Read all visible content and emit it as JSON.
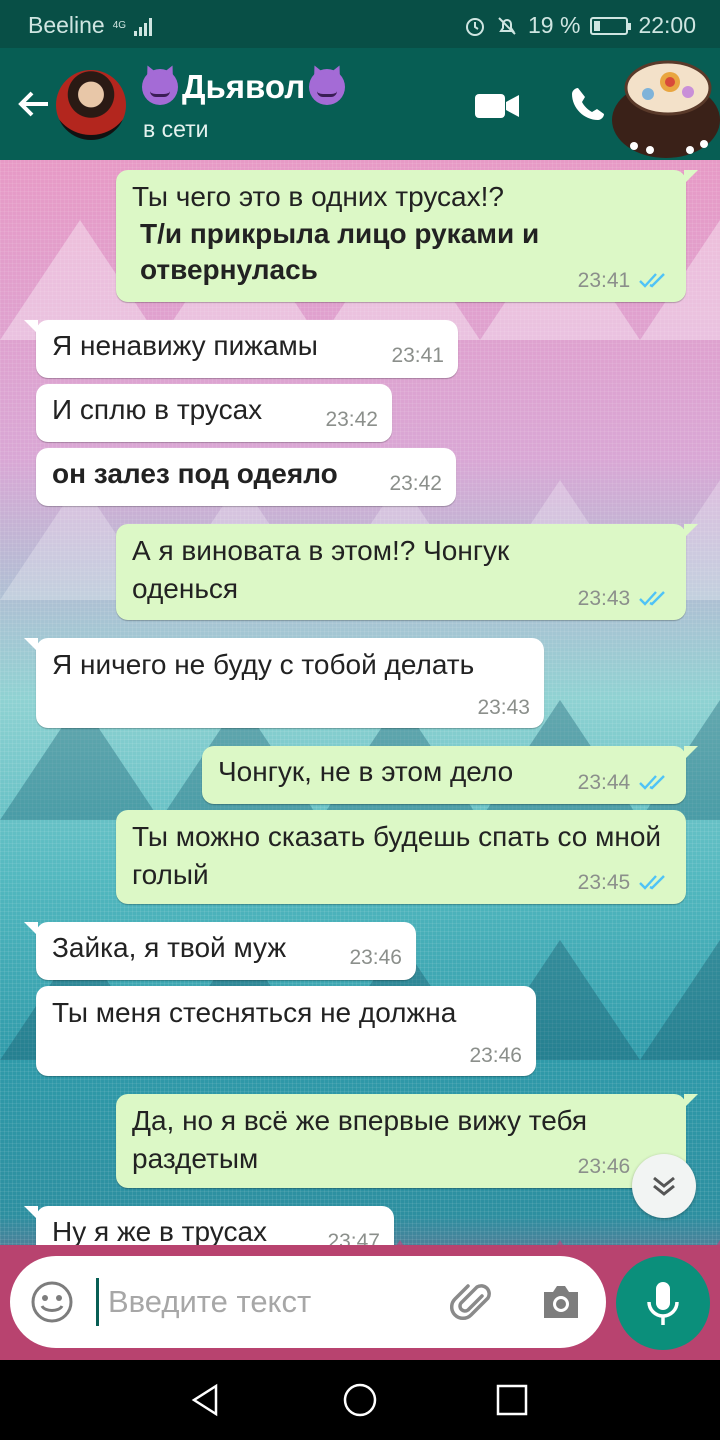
{
  "status_bar": {
    "carrier": "Beeline",
    "network": "4G",
    "battery": "19 %",
    "clock": "22:00"
  },
  "header": {
    "contact_name": "Дьявол",
    "status": "в сети"
  },
  "messages": [
    {
      "dir": "out",
      "text": "Ты чего это в одних трусах!?",
      "bold_text": "Т/и прикрыла лицо руками и отвернулась",
      "time": "23:41",
      "read": true
    },
    {
      "dir": "in",
      "text": "Я ненавижу пижамы",
      "time": "23:41"
    },
    {
      "dir": "in",
      "text": "И сплю в трусах",
      "time": "23:42"
    },
    {
      "dir": "in",
      "text": "он залез под одеяло",
      "bold": true,
      "time": "23:42"
    },
    {
      "dir": "out",
      "text": "А я виновата в этом!? Чонгук оденься",
      "time": "23:43",
      "read": true
    },
    {
      "dir": "in",
      "text": "Я ничего не буду с тобой делать",
      "time": "23:43"
    },
    {
      "dir": "out",
      "text": "Чонгук, не в этом дело",
      "time": "23:44",
      "read": true
    },
    {
      "dir": "out",
      "text": "Ты можно сказать будешь спать со мной голый",
      "time": "23:45",
      "read": true
    },
    {
      "dir": "in",
      "text": "Зайка, я твой муж",
      "time": "23:46"
    },
    {
      "dir": "in",
      "text": "Ты меня стесняться не должна",
      "time": "23:46"
    },
    {
      "dir": "out",
      "text": "Да, но я всё же впервые вижу тебя раздетым",
      "time": "23:46",
      "read": true
    },
    {
      "dir": "in",
      "text": "Ну я же в трусах",
      "time": "23:47"
    }
  ],
  "input": {
    "placeholder": "Введите текст"
  },
  "colors": {
    "header": "#075e54",
    "status_bar": "#084f46",
    "bubble_out": "#dcf8c6",
    "bubble_in": "#ffffff",
    "read_ticks": "#4fc3f7",
    "mic_button": "#0b8f7b"
  },
  "icons": [
    "back-arrow-icon",
    "video-call-icon",
    "phone-icon",
    "emoji-icon",
    "attach-icon",
    "camera-icon",
    "mic-icon",
    "scroll-down-icon"
  ]
}
